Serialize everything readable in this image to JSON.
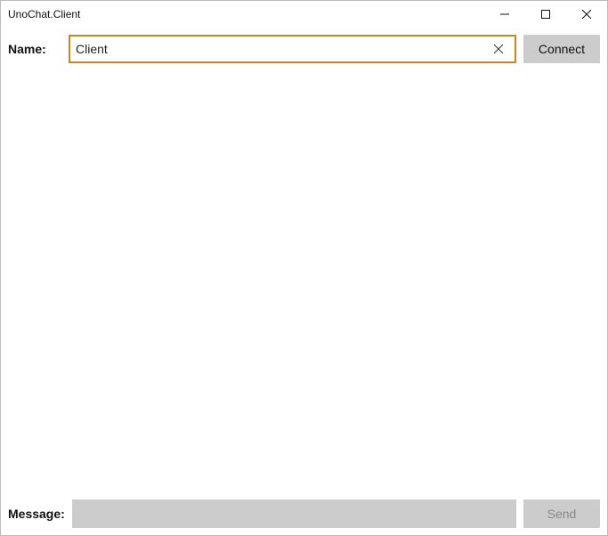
{
  "window": {
    "title": "UnoChat.Client"
  },
  "name_row": {
    "label": "Name:",
    "input_value": "Client",
    "connect_label": "Connect"
  },
  "message_row": {
    "label": "Message:",
    "input_value": "",
    "send_label": "Send"
  }
}
